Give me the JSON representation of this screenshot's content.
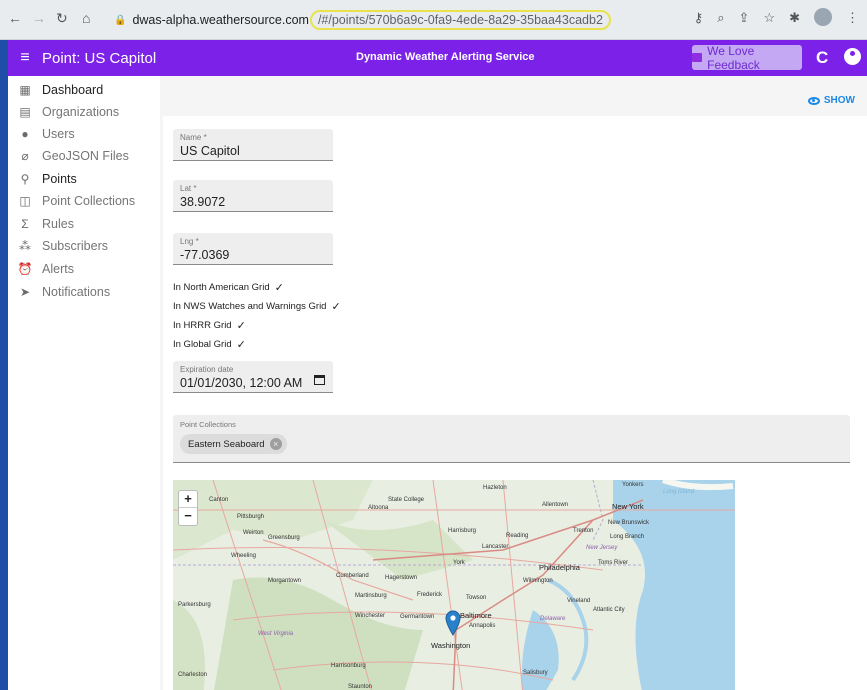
{
  "browser": {
    "host": "dwas-alpha.weathersource.com",
    "path": "/#/points/570b6a9c-0fa9-4ede-8a29-35baa43cadb2"
  },
  "appbar": {
    "title": "Point: US Capitol",
    "center_title": "Dynamic Weather Alerting Service",
    "feedback_label": "We Love Feedback"
  },
  "sidebar": {
    "items": [
      {
        "label": "Dashboard",
        "icon": "dashboard-icon"
      },
      {
        "label": "Organizations",
        "icon": "building-icon"
      },
      {
        "label": "Users",
        "icon": "person-icon"
      },
      {
        "label": "GeoJSON Files",
        "icon": "attachment-icon"
      },
      {
        "label": "Points",
        "icon": "pin-icon"
      },
      {
        "label": "Point Collections",
        "icon": "map-icon"
      },
      {
        "label": "Rules",
        "icon": "sigma-icon"
      },
      {
        "label": "Subscribers",
        "icon": "people-icon"
      },
      {
        "label": "Alerts",
        "icon": "alarm-icon"
      },
      {
        "label": "Notifications",
        "icon": "send-icon"
      }
    ]
  },
  "main": {
    "show_label": "SHOW",
    "name": {
      "label": "Name *",
      "value": "US Capitol"
    },
    "lat": {
      "label": "Lat *",
      "value": "38.9072"
    },
    "lng": {
      "label": "Lng *",
      "value": "-77.0369"
    },
    "grids": [
      {
        "label": "In North American Grid"
      },
      {
        "label": "In NWS Watches and Warnings Grid"
      },
      {
        "label": "In HRRR Grid"
      },
      {
        "label": "In Global Grid"
      }
    ],
    "expiration": {
      "label": "Expiration date",
      "value": "01/01/2030, 12:00 AM"
    },
    "collections": {
      "label": "Point Collections",
      "chip": "Eastern Seaboard"
    }
  },
  "map": {
    "zoom_in": "+",
    "zoom_out": "−",
    "marker_label": "Washington",
    "labels": {
      "altoona": "Altoona",
      "state_college": "State College",
      "hazleton": "Hazleton",
      "allentown": "Allentown",
      "new_york": "New York",
      "long_island": "Long Island",
      "yonkers": "Yonkers",
      "new_brunswick": "New Brunswick",
      "trenton": "Trenton",
      "long_branch": "Long Branch",
      "new_jersey": "New Jersey",
      "harrisburg": "Harrisburg",
      "reading": "Reading",
      "lancaster": "Lancaster",
      "york": "York",
      "philadelphia": "Philadelphia",
      "toms_river": "Toms River",
      "pittsburgh": "Pittsburgh",
      "weirton": "Weirton",
      "greensburg": "Greensburg",
      "wheeling": "Wheeling",
      "morgantown": "Morgantown",
      "cumberland": "Cumberland",
      "hagerstown": "Hagerstown",
      "wilmington": "Wilmington",
      "martinsburg": "Martinsburg",
      "frederick": "Frederick",
      "towson": "Towson",
      "vineland": "Vineland",
      "atlantic_city": "Atlantic City",
      "parkersburg": "Parkersburg",
      "winchester": "Winchester",
      "germantown": "Germantown",
      "baltimore": "Baltimore",
      "annapolis": "Annapolis",
      "delaware": "Delaware",
      "west_virginia": "West Virginia",
      "harrisonburg": "Harrisonburg",
      "salisbury": "Salisbury",
      "charleston": "Charleston",
      "staunton": "Staunton",
      "canton": "Canton"
    }
  },
  "colors": {
    "appbar": "#7c22e8",
    "accent": "#1e88e5",
    "marker": "#2a81cb"
  }
}
